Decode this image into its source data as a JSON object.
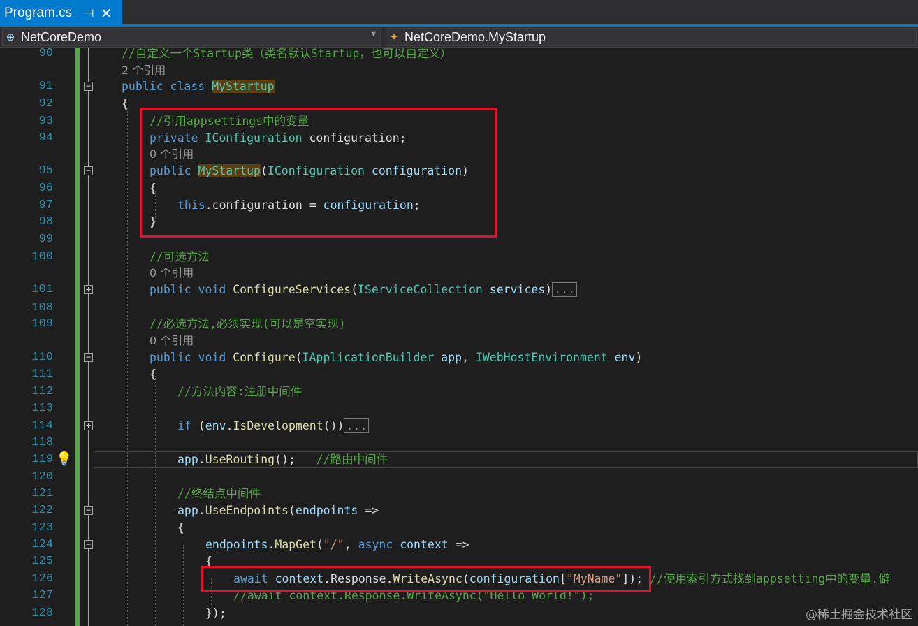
{
  "tab": {
    "title": "Program.cs",
    "pin": "⊣",
    "close": "✕"
  },
  "navbar": {
    "project": "NetCoreDemo",
    "class_path": "NetCoreDemo.MyStartup"
  },
  "code": {
    "l90": {
      "num": "90",
      "comment": "//自定义一个Startup类（类名默认Startup，也可以自定义）"
    },
    "lens1": "2 个引用",
    "l91": {
      "num": "91",
      "kw": "public class ",
      "cls": "MyStartup"
    },
    "l92": {
      "num": "92",
      "text": "{"
    },
    "l93": {
      "num": "93",
      "comment": "//引用appsettings中的变量"
    },
    "l94": {
      "num": "94",
      "kw": "private ",
      "type": "IConfiguration ",
      "name": "configuration",
      "end": ";"
    },
    "lens2": "0 个引用",
    "l95": {
      "num": "95",
      "kw": "public ",
      "ctor": "MyStartup",
      "open": "(",
      "type": "IConfiguration ",
      "param": "configuration",
      "close": ")"
    },
    "l96": {
      "num": "96",
      "text": "{"
    },
    "l97": {
      "num": "97",
      "kw": "this",
      "mid": ".configuration = ",
      "param": "configuration",
      "end": ";"
    },
    "l98": {
      "num": "98",
      "text": "}"
    },
    "l99": {
      "num": "99"
    },
    "l100": {
      "num": "100",
      "comment": "//可选方法"
    },
    "lens3": "0 个引用",
    "l101": {
      "num": "101",
      "kw": "public void ",
      "method": "ConfigureServices",
      "open": "(",
      "type": "IServiceCollection ",
      "param": "services",
      "close": ")",
      "collapsed": "..."
    },
    "l108": {
      "num": "108"
    },
    "l109": {
      "num": "109",
      "comment": "//必选方法,必须实现(可以是空实现)"
    },
    "lens4": "0 个引用",
    "l110": {
      "num": "110",
      "kw": "public void ",
      "method": "Configure",
      "open": "(",
      "type1": "IApplicationBuilder ",
      "param1": "app",
      "sep": ", ",
      "type2": "IWebHostEnvironment ",
      "param2": "env",
      "close": ")"
    },
    "l111": {
      "num": "111",
      "text": "{"
    },
    "l112": {
      "num": "112",
      "comment": "//方法内容:注册中间件"
    },
    "l113": {
      "num": "113"
    },
    "l114": {
      "num": "114",
      "kw": "if ",
      "open": "(",
      "param": "env",
      "dot": ".",
      "method": "IsDevelopment",
      "close": "())",
      "collapsed": "..."
    },
    "l118": {
      "num": "118"
    },
    "l119": {
      "num": "119",
      "param": "app",
      "dot": ".",
      "method": "UseRouting",
      "call": "();   ",
      "comment": "//路由中间件"
    },
    "l120": {
      "num": "120"
    },
    "l121": {
      "num": "121",
      "comment": "//终结点中间件"
    },
    "l122": {
      "num": "122",
      "param": "app",
      "dot": ".",
      "method": "UseEndpoints",
      "open": "(",
      "param2": "endpoints",
      "arrow": " =>"
    },
    "l123": {
      "num": "123",
      "text": "{"
    },
    "l124": {
      "num": "124",
      "param": "endpoints",
      "dot": ".",
      "method": "MapGet",
      "open": "(",
      "str": "\"/\"",
      "sep": ", ",
      "kw": "async ",
      "param2": "context",
      "arrow": " =>"
    },
    "l125": {
      "num": "125",
      "text": "{"
    },
    "l126": {
      "num": "126",
      "kw": "await ",
      "param": "context",
      "mid1": ".",
      "prop": "Response",
      "mid2": ".",
      "method": "WriteAsync",
      "open": "(",
      "param2": "configuration",
      "br1": "[",
      "str": "\"MyName\"",
      "br2": "]);",
      "comment": " //使用索引方式找到appsetting中的变量.僻"
    },
    "l127": {
      "num": "127",
      "comment": "//await context.Response.WriteAsync(\"Hello World!\");"
    },
    "l128": {
      "num": "128",
      "text": "});"
    }
  },
  "watermark": "@稀土掘金技术社区",
  "lightbulb_icon": "lightbulb-icon"
}
